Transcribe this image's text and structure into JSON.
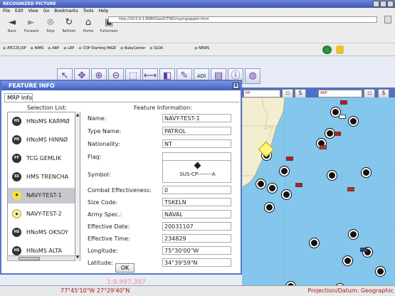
{
  "window": {
    "title": "RECOGNIZED PICTURE"
  },
  "menu": [
    "File",
    "Edit",
    "View",
    "Go",
    "Bookmarks",
    "Tools",
    "Help"
  ],
  "nav": {
    "back": "Back",
    "forward": "Forward",
    "stop": "Stop",
    "refresh": "Refresh",
    "home": "Home",
    "fullscreen": "Fullscreen"
  },
  "address": {
    "url": "http://10.0.0.1:8080/GeoICTWG/rcp/cgiapplet.html"
  },
  "bookmarks": [
    "ATCCIS JSP",
    "NIMS",
    "ARP",
    "LRP",
    "COP Starting PAGE",
    "BabyCenter",
    "SLOX",
    "NEWS"
  ],
  "map_controls": {
    "left_field": "RP",
    "right_field": "ARP"
  },
  "dialog": {
    "title": "FEATURE INFO",
    "tab": "MRP Info",
    "list_heading": "Selection List:",
    "info_heading": "Feature Information:",
    "ok_label": "OK",
    "list": [
      {
        "label": "HNoMS KARMØ",
        "symbol": "HS"
      },
      {
        "label": "HNoMS HINNØ",
        "symbol": "HS"
      },
      {
        "label": "TCG GEMLIK",
        "symbol": "FF"
      },
      {
        "label": "HMS TRENCHA",
        "symbol": "SS"
      },
      {
        "label": "NAVY-TEST-1",
        "symbol": "◆"
      },
      {
        "label": "NAVY-TEST-2",
        "symbol": "◆"
      },
      {
        "label": "HNoMS OKSOY",
        "symbol": "HS"
      },
      {
        "label": "HNoMS ALTA",
        "symbol": "HS"
      }
    ],
    "selected_index": 4,
    "fields": {
      "name_label": "Name:",
      "name_value": "NAVY-TEST-1",
      "type_label": "Type Name:",
      "type_value": "PATROL",
      "nationality_label": "Nationality:",
      "nationality_value": "NT",
      "flag_label": "Flag:",
      "flag_value": "",
      "symbol_label": "Symbol:",
      "symbol_code": "SUS-CP--------A",
      "combat_label": "Combat Effectiveness:",
      "combat_value": "0",
      "size_label": "Size Code:",
      "size_value": "TSKELN",
      "army_label": "Army Spec.:",
      "army_value": "NAVAL",
      "date_label": "Effective Date:",
      "date_value": "20031107",
      "time_label": "Effective Time:",
      "time_value": "234829",
      "longitude_label": "Longitude:",
      "longitude_value": "75°30'00\"W",
      "latitude_label": "Latitude:",
      "latitude_value": "34°39'59\"N"
    }
  },
  "status": {
    "scale": "1:9,997,397",
    "coords": "77°45'10\"W   27°29'40\"N",
    "projection": "Projection/Datum: Geographic"
  },
  "colors": {
    "map_water": "#84c6ec",
    "dialog_title": "#3f5fbf",
    "status_text": "#b01818"
  }
}
